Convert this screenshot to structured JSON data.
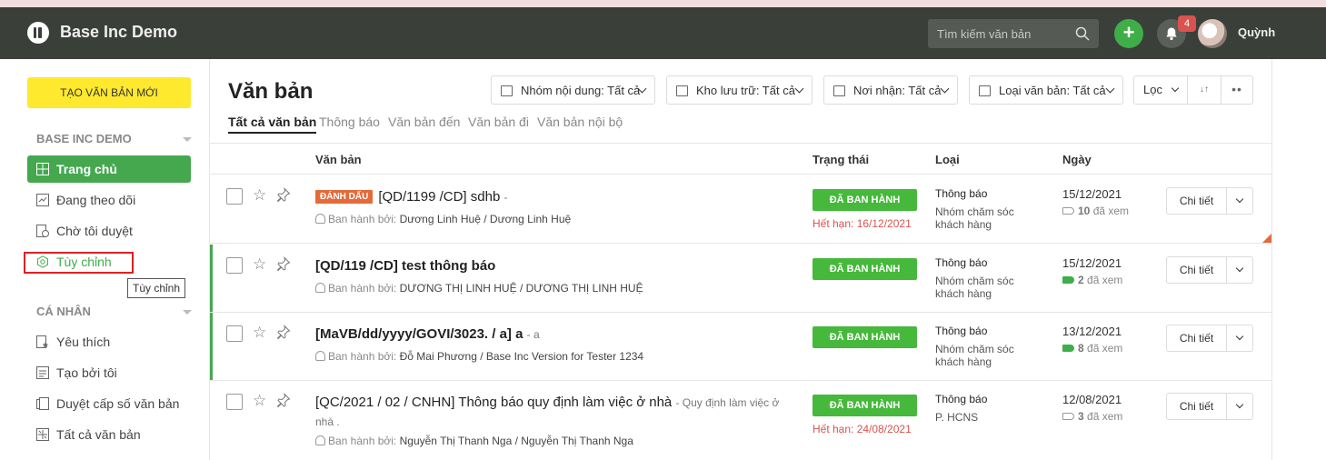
{
  "header": {
    "app_title": "Base Inc Demo",
    "search_placeholder": "Tìm kiếm văn bản",
    "notification_count": "4",
    "username": "Quỳnh",
    "add_label": "+"
  },
  "sidebar": {
    "create_button": "TẠO VĂN BẢN MỚI",
    "section_company": "BASE INC DEMO",
    "section_personal": "CÁ NHÂN",
    "company_items": [
      {
        "label": "Trang chủ",
        "icon": "grid-icon",
        "active": true
      },
      {
        "label": "Đang theo dõi",
        "icon": "chart-icon"
      },
      {
        "label": "Chờ tôi duyệt",
        "icon": "pending-doc-icon"
      },
      {
        "label": "Tùy chỉnh",
        "icon": "settings-icon"
      }
    ],
    "personal_items": [
      {
        "label": "Yêu thích",
        "icon": "favorite-doc-icon"
      },
      {
        "label": "Tạo bởi tôi",
        "icon": "doc-icon"
      },
      {
        "label": "Duyệt cấp số văn bản",
        "icon": "docs-icon"
      },
      {
        "label": "Tất cả văn bản",
        "icon": "calculator-icon"
      }
    ],
    "tooltip": "Tùy chỉnh"
  },
  "main": {
    "title": "Văn bản",
    "filters": [
      {
        "label": "Nhóm nội dung: Tất cả"
      },
      {
        "label": "Kho lưu trữ: Tất cả"
      },
      {
        "label": "Nơi nhận: Tất cả"
      },
      {
        "label": "Loại văn bản: Tất cả"
      }
    ],
    "filter_button": "Lọc",
    "sort_label": "↓↑",
    "more_label": "••",
    "tabs": [
      "Tất cả văn bản",
      "Thông báo",
      "Văn bản đến",
      "Văn bản đi",
      "Văn bản nội bộ"
    ],
    "columns": {
      "doc": "Văn bản",
      "status": "Trạng thái",
      "type": "Loại",
      "date": "Ngày"
    },
    "rows": [
      {
        "tag": "ĐÁNH DẤU",
        "title": "[QD/1199 /CD] sdhb",
        "subtitle": "-",
        "issuer_label": "Ban hành bởi:",
        "issuer": "Dương Linh Huệ / Dương Linh Huệ",
        "status": "ĐÃ BAN HÀNH",
        "expiry": "Hết hạn: 16/12/2021",
        "type": "Thông báo",
        "group": "Nhóm chăm sóc khách hàng",
        "date": "15/12/2021",
        "views": "10",
        "views_label": "đã xem"
      },
      {
        "title": "[QD/119 /CD] test thông báo",
        "issuer_label": "Ban hành bởi:",
        "issuer": "DƯƠNG THỊ LINH HUỆ / DƯƠNG THỊ LINH HUỆ",
        "status": "ĐÃ BAN HÀNH",
        "type": "Thông báo",
        "group": "Nhóm chăm sóc khách hàng",
        "date": "15/12/2021",
        "views": "2",
        "views_label": "đã xem"
      },
      {
        "title": "[MaVB/dd/yyyy/GOVI/3023. / a] a",
        "subtitle": "- a",
        "issuer_label": "Ban hành bởi:",
        "issuer": "Đỗ Mai Phương / Base Inc Version for Tester 1234",
        "status": "ĐÃ BAN HÀNH",
        "type": "Thông báo",
        "group": "Nhóm chăm sóc khách hàng",
        "date": "13/12/2021",
        "views": "8",
        "views_label": "đã xem"
      },
      {
        "title": "[QC/2021 / 02 / CNHN] Thông báo quy định làm việc ở nhà",
        "subtitle": "- Quy định làm việc ở",
        "subtitle2": "nhà .",
        "issuer_label": "Ban hành bởi:",
        "issuer": "Nguyễn Thị Thanh Nga / Nguyễn Thị Thanh Nga",
        "status": "ĐÃ BAN HÀNH",
        "expiry": "Hết hạn: 24/08/2021",
        "type": "Thông báo",
        "group": "P. HCNS",
        "date": "12/08/2021",
        "views": "3",
        "views_label": "đã xem"
      }
    ],
    "detail_button": "Chi tiết"
  },
  "colors": {
    "accent_green": "#45a84f",
    "header_bg": "#3b3f3a",
    "create_yellow": "#ffe92e",
    "tag_orange": "#e36b3a",
    "expiry_red": "#d9534f"
  }
}
